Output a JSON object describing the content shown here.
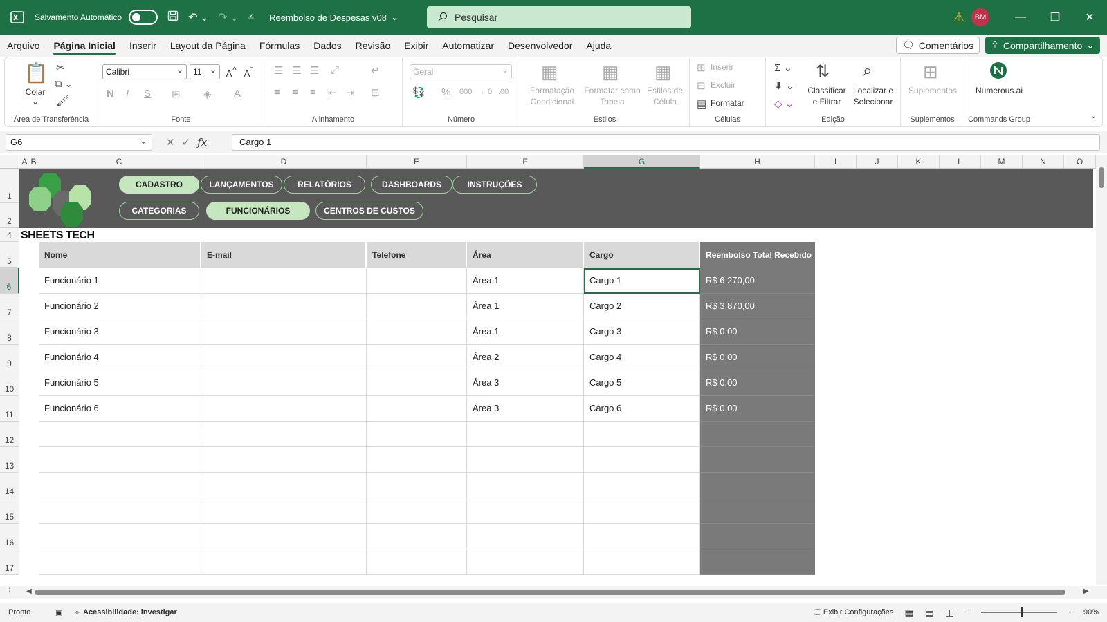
{
  "titlebar": {
    "autosave_label": "Salvamento Automático",
    "filename": "Reembolso de Despesas v08",
    "search_placeholder": "Pesquisar",
    "avatar_initials": "BM"
  },
  "menu": {
    "tabs": [
      "Arquivo",
      "Página Inicial",
      "Inserir",
      "Layout da Página",
      "Fórmulas",
      "Dados",
      "Revisão",
      "Exibir",
      "Automatizar",
      "Desenvolvedor",
      "Ajuda"
    ],
    "active": "Página Inicial",
    "comments_label": "Comentários",
    "share_label": "Compartilhamento"
  },
  "ribbon": {
    "clipboard": {
      "paste": "Colar",
      "label": "Área de Transferência"
    },
    "font": {
      "name": "Calibri",
      "size": "11",
      "label": "Fonte"
    },
    "alignment": {
      "label": "Alinhamento"
    },
    "number": {
      "format": "Geral",
      "label": "Número"
    },
    "styles": {
      "conditional": "Formatação Condicional",
      "table": "Formatar como Tabela",
      "cell": "Estilos de Célula",
      "label": "Estilos"
    },
    "cells": {
      "insert": "Inserir",
      "delete": "Excluir",
      "format": "Formatar",
      "label": "Células"
    },
    "editing": {
      "sort": "Classificar e Filtrar",
      "find": "Localizar e Selecionar",
      "label": "Edição"
    },
    "addins": {
      "button": "Suplementos",
      "label": "Suplementos"
    },
    "commands": {
      "button": "Numerous.ai",
      "label": "Commands Group"
    }
  },
  "formula_bar": {
    "cell_ref": "G6",
    "value": "Cargo 1"
  },
  "columns": [
    "A",
    "B",
    "C",
    "D",
    "E",
    "F",
    "G",
    "H",
    "I",
    "J",
    "K",
    "L",
    "M",
    "N",
    "O"
  ],
  "rows": [
    "1",
    "2",
    "4",
    "5",
    "6",
    "7",
    "8",
    "9",
    "10",
    "11",
    "12",
    "13",
    "14",
    "15",
    "16",
    "17"
  ],
  "banner": {
    "brand": "SHEETS TECH",
    "nav_top": [
      "CADASTRO",
      "LANÇAMENTOS",
      "RELATÓRIOS",
      "DASHBOARDS",
      "INSTRUÇÕES"
    ],
    "nav_bottom": [
      "CATEGORIAS",
      "FUNCIONÁRIOS",
      "CENTROS DE CUSTOS"
    ],
    "nav_top_active": "CADASTRO",
    "nav_bottom_active": "FUNCIONÁRIOS"
  },
  "table": {
    "headers": [
      "Nome",
      "E-mail",
      "Telefone",
      "Área",
      "Cargo",
      "Reembolso Total Recebido"
    ],
    "rows": [
      [
        "Funcionário 1",
        "",
        "",
        "Área 1",
        "Cargo 1",
        "R$ 6.270,00"
      ],
      [
        "Funcionário 2",
        "",
        "",
        "Área 1",
        "Cargo 2",
        "R$ 3.870,00"
      ],
      [
        "Funcionário 3",
        "",
        "",
        "Área 1",
        "Cargo 3",
        "R$ 0,00"
      ],
      [
        "Funcionário 4",
        "",
        "",
        "Área 2",
        "Cargo 4",
        "R$ 0,00"
      ],
      [
        "Funcionário 5",
        "",
        "",
        "Área 3",
        "Cargo 5",
        "R$ 0,00"
      ],
      [
        "Funcionário 6",
        "",
        "",
        "Área 3",
        "Cargo 6",
        "R$ 0,00"
      ]
    ]
  },
  "statusbar": {
    "ready": "Pronto",
    "accessibility": "Acessibilidade: investigar",
    "display_settings": "Exibir Configurações",
    "zoom": "90%"
  },
  "colors": {
    "accent": "#1e7145",
    "banner": "#595959",
    "nav_active": "#c6e6bf",
    "header_dark": "#7a7a7a"
  }
}
